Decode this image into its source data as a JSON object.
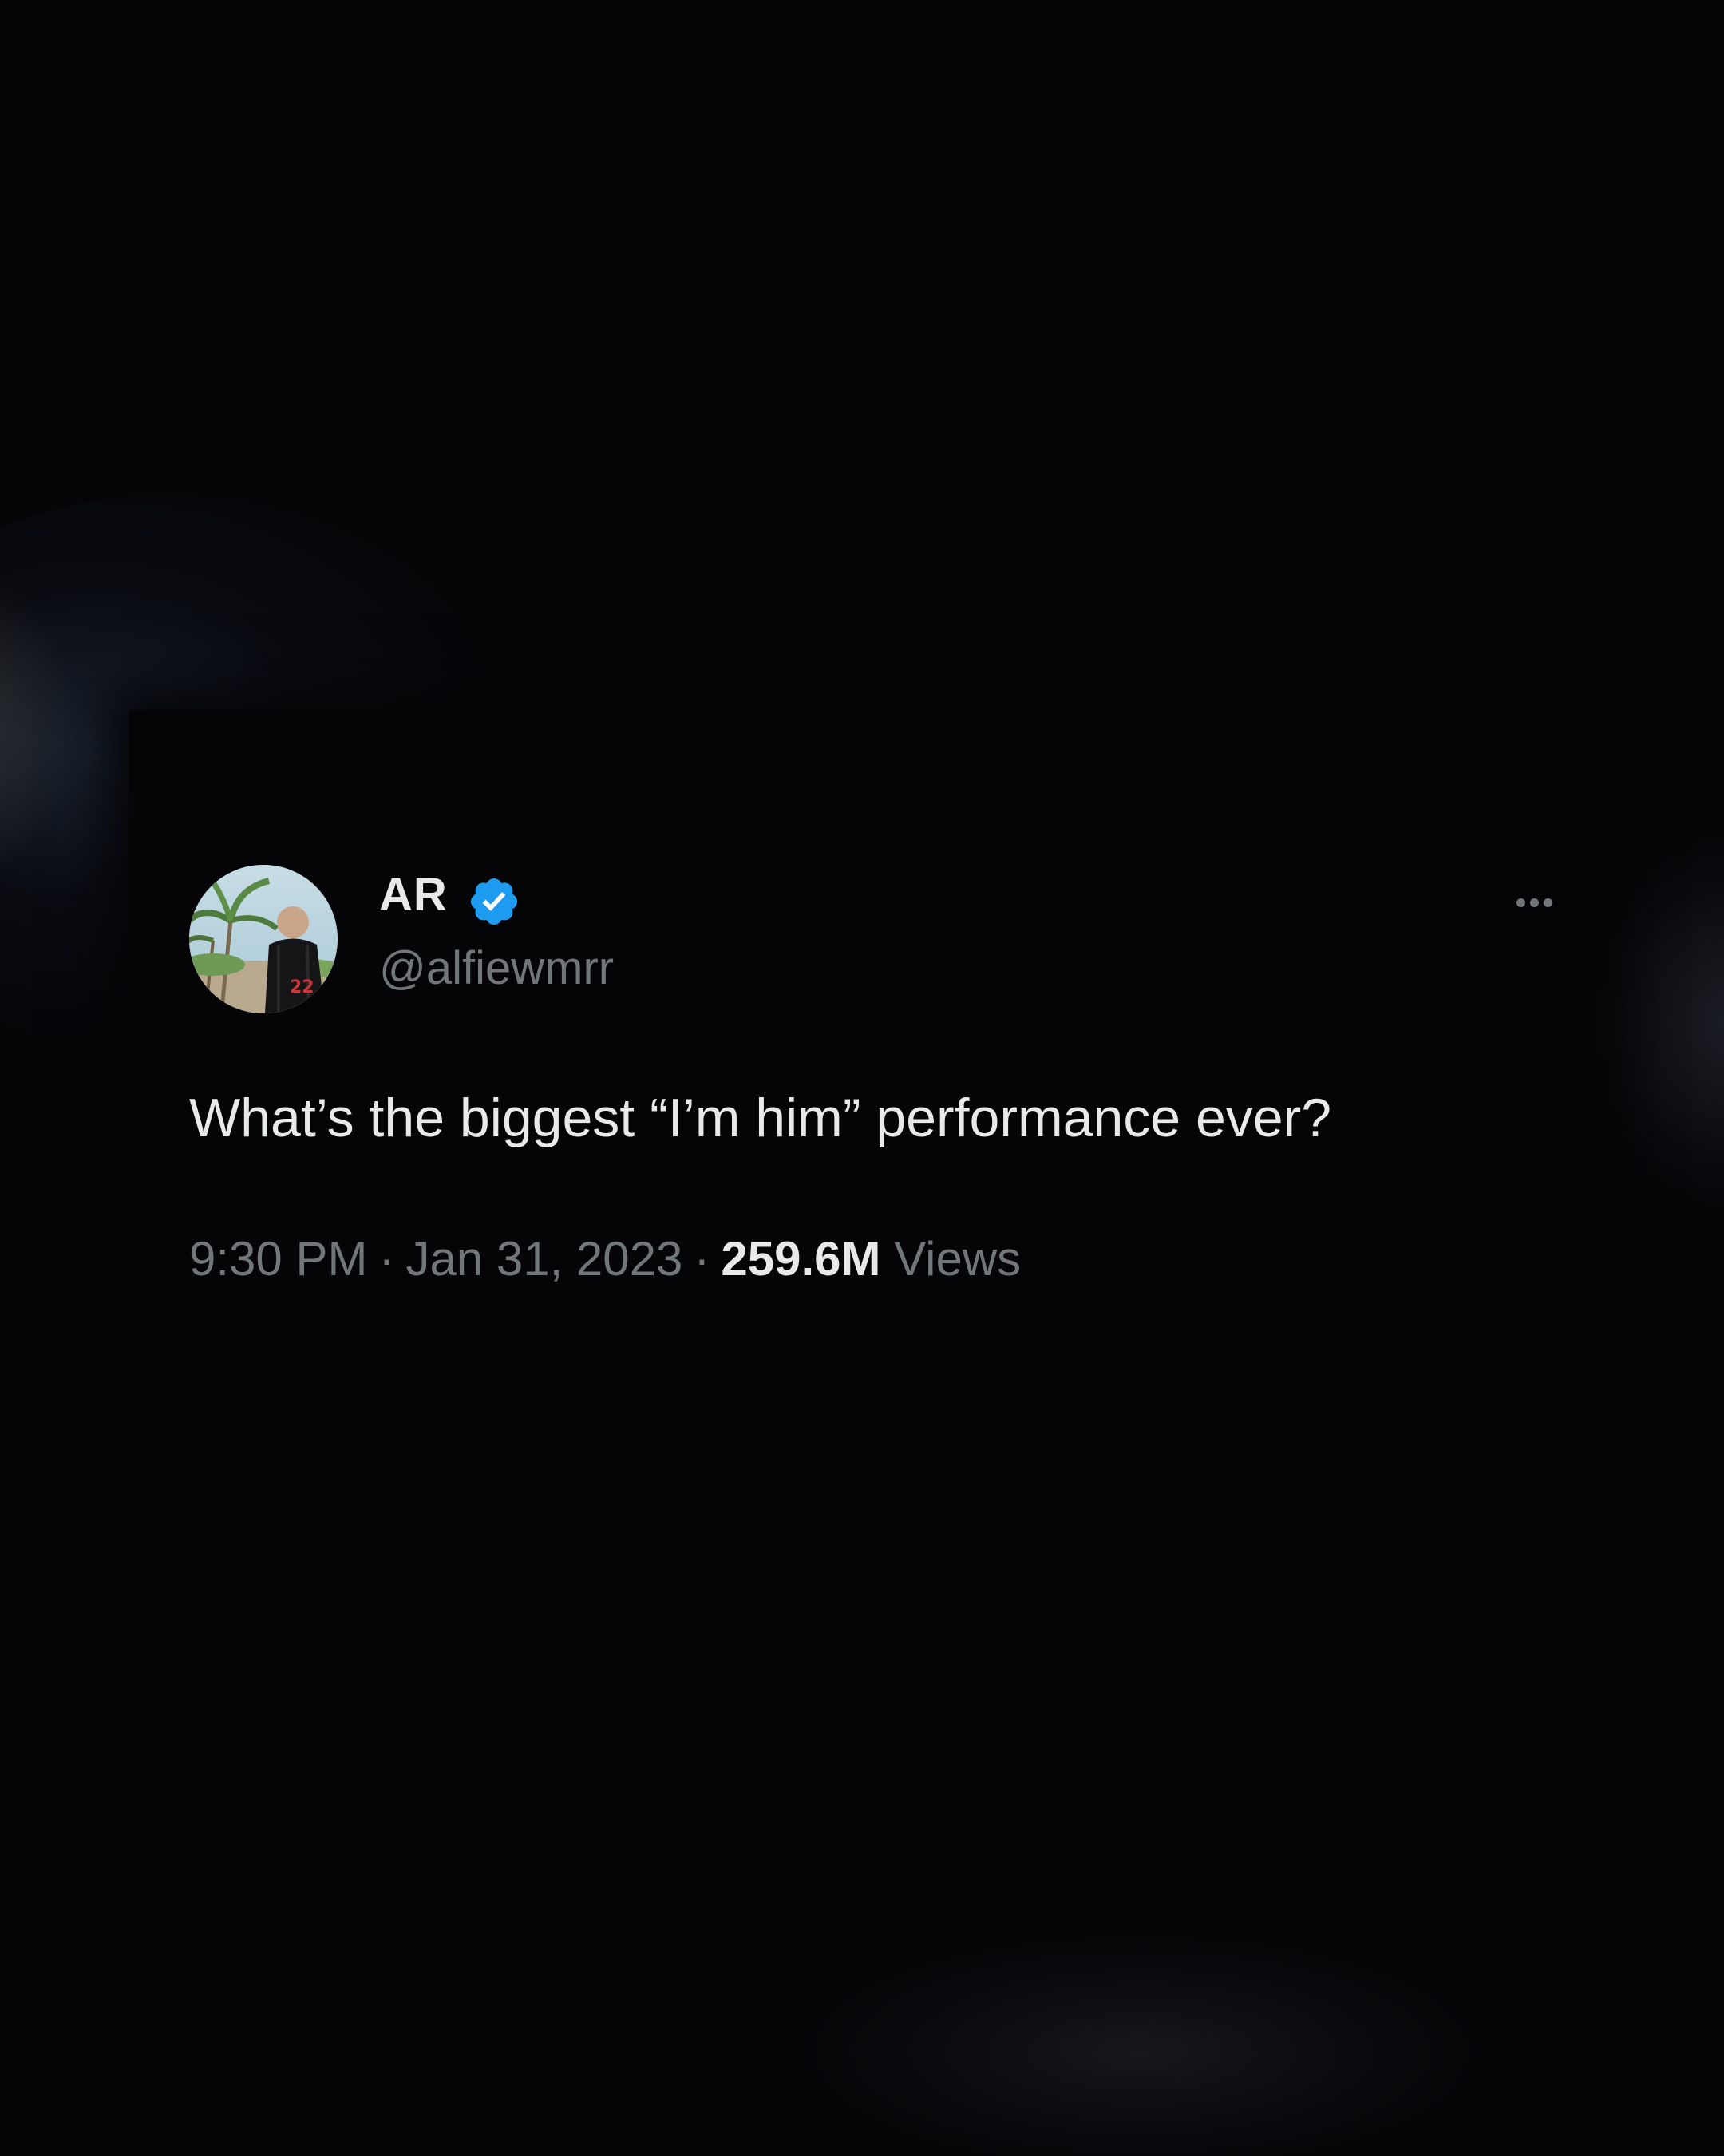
{
  "tweet": {
    "display_name": "AR",
    "handle": "@alfiewmrr",
    "text": "What’s the biggest “I’m him” performance ever?",
    "time": "9:30 PM",
    "separator": "·",
    "date": "Jan 31, 2023",
    "views_count": "259.6M",
    "views_label": "Views",
    "verified_icon": "verified-badge-icon",
    "more_icon": "more-options-icon",
    "avatar_jersey_number": "22"
  },
  "colors": {
    "background": "#050407",
    "primary_text": "#e7e9ea",
    "secondary_text": "#71767b",
    "verified_blue": "#1d9bf0"
  }
}
